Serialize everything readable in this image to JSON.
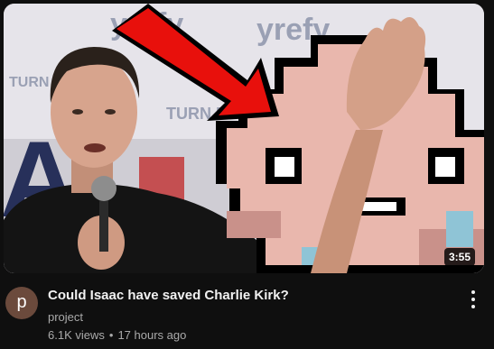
{
  "video": {
    "title": "Could Isaac have saved Charlie Kirk?",
    "channel": "project",
    "avatar_letter": "p",
    "views": "6.1K views",
    "separator": "•",
    "age": "17 hours ago",
    "duration": "3:55"
  },
  "thumbnail": {
    "banner_text": "yrefy",
    "banner_text_small": "TURN POINT",
    "banner_partial_letter": "A"
  },
  "icons": {
    "menu": "more-vert-icon",
    "arrow": "red-arrow-icon"
  },
  "colors": {
    "background": "#0f0f0f",
    "avatar": "#6b4a3c",
    "arrow": "#e8100c",
    "isaac_skin": "#e9b7ad",
    "isaac_shadow": "#c9918a",
    "tear": "#8fc4d6"
  }
}
